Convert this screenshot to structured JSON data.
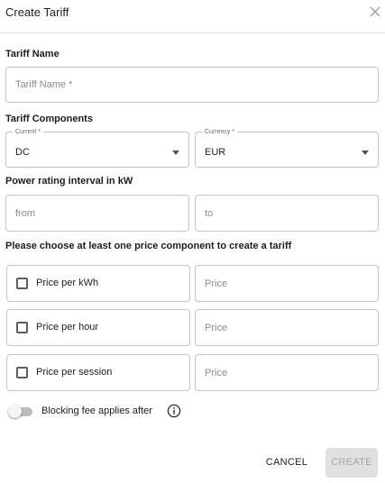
{
  "dialog": {
    "title": "Create Tariff"
  },
  "sections": {
    "tariff_name": "Tariff Name",
    "tariff_components": "Tariff Components",
    "power_interval": "Power rating interval in kW",
    "price_components": "Please choose at least one price component to create a tariff"
  },
  "tariff_name_field": {
    "placeholder": "Tariff Name *",
    "value": ""
  },
  "current_select": {
    "legend": "Current *",
    "value": "DC"
  },
  "currency_select": {
    "legend": "Currency *",
    "value": "EUR"
  },
  "power_interval": {
    "from": {
      "placeholder": "from",
      "value": ""
    },
    "to": {
      "placeholder": "to",
      "value": ""
    }
  },
  "price_components": [
    {
      "label": "Price per kWh",
      "checked": false,
      "price_placeholder": "Price"
    },
    {
      "label": "Price per hour",
      "checked": false,
      "price_placeholder": "Price"
    },
    {
      "label": "Price per session",
      "checked": false,
      "price_placeholder": "Price"
    }
  ],
  "blocking_fee": {
    "label": "Blocking fee applies after",
    "enabled": false,
    "icon": "info-icon"
  },
  "actions": {
    "cancel": "CANCEL",
    "create": "CREATE",
    "create_disabled": true
  },
  "colors": {
    "border": "#c4c4c4",
    "disabled_bg": "#e0e0e0",
    "disabled_text": "#a6a6a6"
  }
}
